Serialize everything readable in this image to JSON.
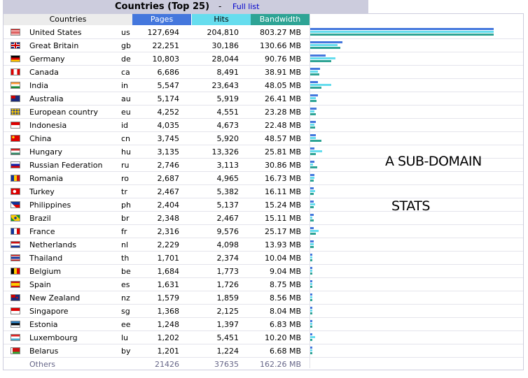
{
  "header": {
    "title": "Countries (Top 25)",
    "separator": "-",
    "full_list_link": "Full list"
  },
  "columns": {
    "countries": "Countries",
    "pages": "Pages",
    "hits": "Hits",
    "bandwidth": "Bandwidth"
  },
  "rows": [
    {
      "name": "United States",
      "code": "us",
      "pages": "127,694",
      "hits": "204,810",
      "bandwidth": "803.27 MB",
      "pv": 127694,
      "hv": 204810,
      "bv": 803.27,
      "flag": "flag-us-icon"
    },
    {
      "name": "Great Britain",
      "code": "gb",
      "pages": "22,251",
      "hits": "30,186",
      "bandwidth": "130.66 MB",
      "pv": 22251,
      "hv": 30186,
      "bv": 130.66,
      "flag": "flag-gb-icon"
    },
    {
      "name": "Germany",
      "code": "de",
      "pages": "10,803",
      "hits": "28,044",
      "bandwidth": "90.76 MB",
      "pv": 10803,
      "hv": 28044,
      "bv": 90.76,
      "flag": "flag-de-icon"
    },
    {
      "name": "Canada",
      "code": "ca",
      "pages": "6,686",
      "hits": "8,491",
      "bandwidth": "38.91 MB",
      "pv": 6686,
      "hv": 8491,
      "bv": 38.91,
      "flag": "flag-ca-icon"
    },
    {
      "name": "India",
      "code": "in",
      "pages": "5,547",
      "hits": "23,643",
      "bandwidth": "48.05 MB",
      "pv": 5547,
      "hv": 23643,
      "bv": 48.05,
      "flag": "flag-in-icon"
    },
    {
      "name": "Australia",
      "code": "au",
      "pages": "5,174",
      "hits": "5,919",
      "bandwidth": "26.41 MB",
      "pv": 5174,
      "hv": 5919,
      "bv": 26.41,
      "flag": "flag-au-icon"
    },
    {
      "name": "European country",
      "code": "eu",
      "pages": "4,252",
      "hits": "4,551",
      "bandwidth": "23.28 MB",
      "pv": 4252,
      "hv": 4551,
      "bv": 23.28,
      "flag": "flag-eu-icon"
    },
    {
      "name": "Indonesia",
      "code": "id",
      "pages": "4,035",
      "hits": "4,673",
      "bandwidth": "22.48 MB",
      "pv": 4035,
      "hv": 4673,
      "bv": 22.48,
      "flag": "flag-id-icon"
    },
    {
      "name": "China",
      "code": "cn",
      "pages": "3,745",
      "hits": "5,920",
      "bandwidth": "48.57 MB",
      "pv": 3745,
      "hv": 5920,
      "bv": 48.57,
      "flag": "flag-cn-icon"
    },
    {
      "name": "Hungary",
      "code": "hu",
      "pages": "3,135",
      "hits": "13,326",
      "bandwidth": "25.81 MB",
      "pv": 3135,
      "hv": 13326,
      "bv": 25.81,
      "flag": "flag-hu-icon"
    },
    {
      "name": "Russian Federation",
      "code": "ru",
      "pages": "2,746",
      "hits": "3,113",
      "bandwidth": "30.86 MB",
      "pv": 2746,
      "hv": 3113,
      "bv": 30.86,
      "flag": "flag-ru-icon"
    },
    {
      "name": "Romania",
      "code": "ro",
      "pages": "2,687",
      "hits": "4,965",
      "bandwidth": "16.73 MB",
      "pv": 2687,
      "hv": 4965,
      "bv": 16.73,
      "flag": "flag-ro-icon"
    },
    {
      "name": "Turkey",
      "code": "tr",
      "pages": "2,467",
      "hits": "5,382",
      "bandwidth": "16.11 MB",
      "pv": 2467,
      "hv": 5382,
      "bv": 16.11,
      "flag": "flag-tr-icon"
    },
    {
      "name": "Philippines",
      "code": "ph",
      "pages": "2,404",
      "hits": "5,137",
      "bandwidth": "15.24 MB",
      "pv": 2404,
      "hv": 5137,
      "bv": 15.24,
      "flag": "flag-ph-icon"
    },
    {
      "name": "Brazil",
      "code": "br",
      "pages": "2,348",
      "hits": "2,467",
      "bandwidth": "15.11 MB",
      "pv": 2348,
      "hv": 2467,
      "bv": 15.11,
      "flag": "flag-br-icon"
    },
    {
      "name": "France",
      "code": "fr",
      "pages": "2,316",
      "hits": "9,576",
      "bandwidth": "25.17 MB",
      "pv": 2316,
      "hv": 9576,
      "bv": 25.17,
      "flag": "flag-fr-icon"
    },
    {
      "name": "Netherlands",
      "code": "nl",
      "pages": "2,229",
      "hits": "4,098",
      "bandwidth": "13.93 MB",
      "pv": 2229,
      "hv": 4098,
      "bv": 13.93,
      "flag": "flag-nl-icon"
    },
    {
      "name": "Thailand",
      "code": "th",
      "pages": "1,701",
      "hits": "2,374",
      "bandwidth": "10.04 MB",
      "pv": 1701,
      "hv": 2374,
      "bv": 10.04,
      "flag": "flag-th-icon"
    },
    {
      "name": "Belgium",
      "code": "be",
      "pages": "1,684",
      "hits": "1,773",
      "bandwidth": "9.04 MB",
      "pv": 1684,
      "hv": 1773,
      "bv": 9.04,
      "flag": "flag-be-icon"
    },
    {
      "name": "Spain",
      "code": "es",
      "pages": "1,631",
      "hits": "1,726",
      "bandwidth": "8.75 MB",
      "pv": 1631,
      "hv": 1726,
      "bv": 8.75,
      "flag": "flag-es-icon"
    },
    {
      "name": "New Zealand",
      "code": "nz",
      "pages": "1,579",
      "hits": "1,859",
      "bandwidth": "8.56 MB",
      "pv": 1579,
      "hv": 1859,
      "bv": 8.56,
      "flag": "flag-nz-icon"
    },
    {
      "name": "Singapore",
      "code": "sg",
      "pages": "1,368",
      "hits": "2,125",
      "bandwidth": "8.04 MB",
      "pv": 1368,
      "hv": 2125,
      "bv": 8.04,
      "flag": "flag-sg-icon"
    },
    {
      "name": "Estonia",
      "code": "ee",
      "pages": "1,248",
      "hits": "1,397",
      "bandwidth": "6.83 MB",
      "pv": 1248,
      "hv": 1397,
      "bv": 6.83,
      "flag": "flag-ee-icon"
    },
    {
      "name": "Luxembourg",
      "code": "lu",
      "pages": "1,202",
      "hits": "5,451",
      "bandwidth": "10.20 MB",
      "pv": 1202,
      "hv": 5451,
      "bv": 10.2,
      "flag": "flag-lu-icon"
    },
    {
      "name": "Belarus",
      "code": "by",
      "pages": "1,201",
      "hits": "1,224",
      "bandwidth": "6.68 MB",
      "pv": 1201,
      "hv": 1224,
      "bv": 6.68,
      "flag": "flag-by-icon"
    }
  ],
  "others": {
    "name": "Others",
    "pages": "21426",
    "hits": "37635",
    "bandwidth": "162.26 MB"
  },
  "annotation": {
    "line1": "A SUB-DOMAIN",
    "line2": "STATS"
  },
  "colors": {
    "pages": "#4477dd",
    "hits": "#66ddee",
    "bandwidth": "#2ea495",
    "title_bg": "#ccccdd",
    "link": "#0000cc"
  }
}
